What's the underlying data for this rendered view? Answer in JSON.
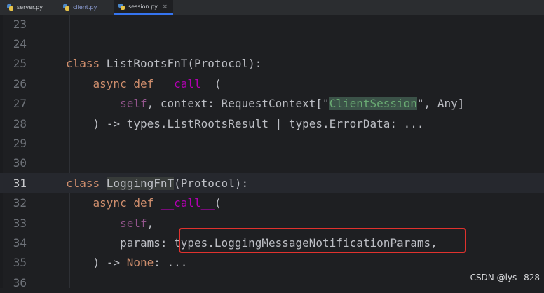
{
  "tabs": [
    {
      "label": "server.py",
      "active": false,
      "modified": false
    },
    {
      "label": "client.py",
      "active": false,
      "modified": true
    },
    {
      "label": "session.py",
      "active": true,
      "modified": false
    }
  ],
  "editor": {
    "current_line": "31",
    "lines": [
      {
        "num": "23",
        "segments": []
      },
      {
        "num": "24",
        "segments": []
      },
      {
        "num": "25",
        "segments": [
          {
            "t": "class ",
            "c": "kw"
          },
          {
            "t": "ListRootsFnT(Protocol):",
            "c": ""
          }
        ]
      },
      {
        "num": "26",
        "segments": [
          {
            "t": "    ",
            "c": ""
          },
          {
            "t": "async def ",
            "c": "kw"
          },
          {
            "t": "__call__",
            "c": "dunder"
          },
          {
            "t": "(",
            "c": ""
          }
        ]
      },
      {
        "num": "27",
        "segments": [
          {
            "t": "        ",
            "c": ""
          },
          {
            "t": "self",
            "c": "self"
          },
          {
            "t": ", context: RequestContext[\"",
            "c": ""
          },
          {
            "t": "ClientSession",
            "c": "hl"
          },
          {
            "t": "\", Any]",
            "c": ""
          }
        ]
      },
      {
        "num": "28",
        "segments": [
          {
            "t": "    ) -> types.ListRootsResult | types.ErrorData: ...",
            "c": ""
          }
        ]
      },
      {
        "num": "29",
        "segments": []
      },
      {
        "num": "30",
        "segments": []
      },
      {
        "num": "31",
        "segments": [
          {
            "t": "class ",
            "c": "kw"
          },
          {
            "t": "LoggingFnT",
            "c": "ref-hl"
          },
          {
            "t": "(Protocol):",
            "c": ""
          }
        ]
      },
      {
        "num": "32",
        "segments": [
          {
            "t": "    ",
            "c": ""
          },
          {
            "t": "async def ",
            "c": "kw"
          },
          {
            "t": "__call__",
            "c": "dunder"
          },
          {
            "t": "(",
            "c": ""
          }
        ]
      },
      {
        "num": "33",
        "segments": [
          {
            "t": "        ",
            "c": ""
          },
          {
            "t": "self",
            "c": "self"
          },
          {
            "t": ",",
            "c": ""
          }
        ]
      },
      {
        "num": "34",
        "segments": [
          {
            "t": "        params: types.LoggingMessageNotificationParams,",
            "c": ""
          }
        ]
      },
      {
        "num": "35",
        "segments": [
          {
            "t": "    ) -> ",
            "c": ""
          },
          {
            "t": "None",
            "c": "kw"
          },
          {
            "t": ": ...",
            "c": ""
          }
        ]
      },
      {
        "num": "36",
        "segments": []
      }
    ]
  },
  "annotation": {
    "color": "#e0322e",
    "target_line": "34"
  },
  "watermark": "CSDN @lys _828",
  "colors": {
    "background": "#1e1f22",
    "keyword": "#cf8e6d",
    "dunder": "#b200b2",
    "self": "#94558d",
    "string_highlight": "#6aab73"
  }
}
